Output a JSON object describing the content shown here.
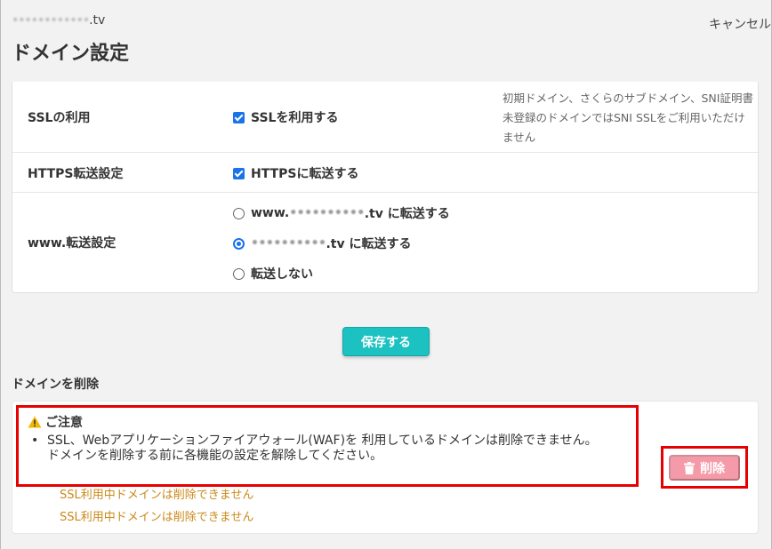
{
  "header": {
    "domain_blurred": "••••••••••••",
    "domain_suffix": ".tv",
    "cancel_label": "キャンセル",
    "title": "ドメイン設定"
  },
  "settings": {
    "ssl": {
      "label": "SSLの利用",
      "checkbox_label": "SSLを利用する",
      "checked": true,
      "note": "初期ドメイン、さくらのサブドメイン、SNI証明書未登録のドメインではSNI SSLをご利用いただけません"
    },
    "https": {
      "label": "HTTPS転送設定",
      "checkbox_label": "HTTPSに転送する",
      "checked": true
    },
    "www": {
      "label": "www.転送設定",
      "options": [
        {
          "prefix": "www.",
          "blurred": "••••••••••",
          "suffix": ".tv に転送する",
          "selected": false
        },
        {
          "prefix": "",
          "blurred": "••••••••••",
          "suffix": ".tv に転送する",
          "selected": true
        },
        {
          "prefix": "",
          "blurred": "",
          "suffix": "転送しない",
          "selected": false
        }
      ]
    }
  },
  "save_label": "保存する",
  "delete_section": {
    "heading": "ドメインを削除",
    "warning_title": "ご注意",
    "warning_text_1": "SSL、Webアプリケーションファイアウォール(WAF)を 利用しているドメインは削除できません。",
    "warning_text_2": "ドメインを削除する前に各機能の設定を解除してください。",
    "errors": [
      "SSL利用中ドメインは削除できません",
      "SSL利用中ドメインは削除できません"
    ],
    "delete_label": "削除"
  },
  "colors": {
    "save_button": "#1cc1c1",
    "delete_button_disabled": "#f59aa8",
    "highlight_border": "#e60000",
    "error_text": "#c98a1a",
    "checkbox": "#1a73e8"
  }
}
